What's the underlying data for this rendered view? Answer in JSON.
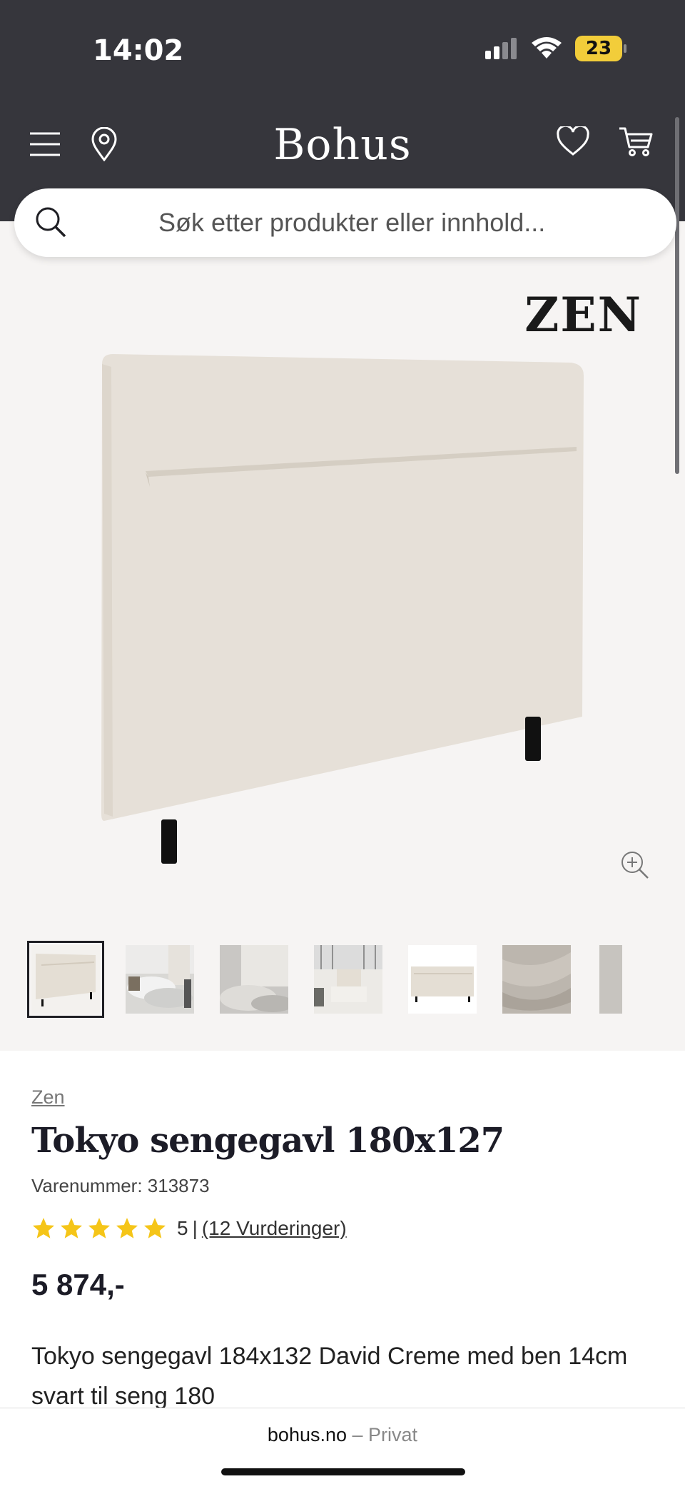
{
  "status_bar": {
    "time": "14:02",
    "battery": "23"
  },
  "header": {
    "logo": "Bohus",
    "icons": [
      "menu-icon",
      "location-pin-icon",
      "heart-icon",
      "cart-icon"
    ]
  },
  "search": {
    "placeholder": "Søk etter produkter eller innhold..."
  },
  "gallery": {
    "brand_mark": "ZEN",
    "thumbnail_count": 7,
    "active_thumbnail": 1
  },
  "product": {
    "brand": "Zen",
    "title": "Tokyo sengegavl 180x127",
    "sku": "Varenummer: 313873",
    "rating_value": "5",
    "rating_sep": "|",
    "rating_count_label": "(12 Vurderinger)",
    "stars": 5,
    "price": "5 874,-",
    "description": "Tokyo sengegavl 184x132 David Creme med ben 14cm svart til seng 180"
  },
  "browser": {
    "domain": "bohus.no",
    "separator": " – ",
    "mode": "Privat"
  },
  "colors": {
    "header_bg": "#36363c",
    "star": "#f5c518",
    "battery": "#f2cd3a",
    "gallery_bg": "#f6f4f3"
  }
}
